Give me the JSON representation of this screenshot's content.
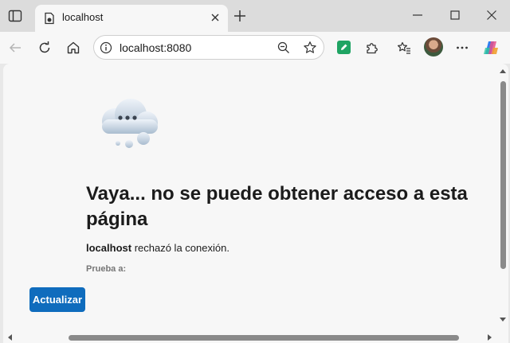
{
  "tab": {
    "title": "localhost"
  },
  "address": {
    "url": "localhost:8080"
  },
  "icons": {
    "sidebar": "sidebar-icon",
    "favicon": "page-icon",
    "close_tab": "close-icon",
    "new_tab": "plus-icon",
    "minimize": "minimize-icon",
    "maximize": "maximize-icon",
    "close_window": "close-icon",
    "back": "back-arrow-icon",
    "reload": "reload-icon",
    "home": "home-icon",
    "site_info": "info-icon",
    "zoom": "zoom-out-icon",
    "favorite": "star-icon",
    "extension": "puzzle-icon",
    "favorites": "favorites-icon",
    "menu": "more-icon",
    "copilot": "copilot-icon"
  },
  "error": {
    "title": "Vaya... no se puede obtener acceso a esta página",
    "host": "localhost",
    "desc_rest": " rechazó la conexión.",
    "try_label": "Prueba a:",
    "refresh_label": "Actualizar"
  },
  "colors": {
    "accent": "#0f6cbd",
    "extension": "#1fa463"
  }
}
